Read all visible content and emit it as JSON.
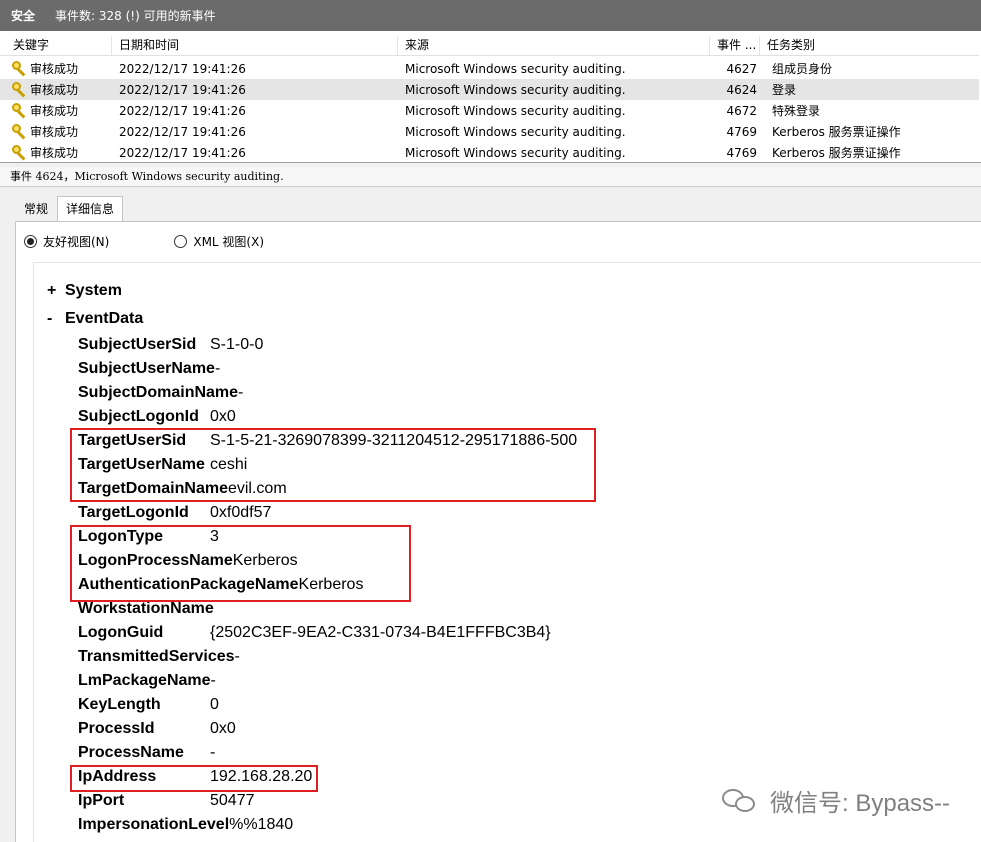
{
  "header": {
    "title": "安全",
    "event_count": "事件数: 328 (!) 可用的新事件"
  },
  "grid": {
    "columns": [
      "关键字",
      "日期和时间",
      "来源",
      "事件 ...",
      "任务类别"
    ],
    "rows": [
      {
        "keyword": "审核成功",
        "datetime": "2022/12/17 19:41:26",
        "source": "Microsoft Windows security auditing.",
        "event_id": "4627",
        "task": "组成员身份"
      },
      {
        "keyword": "审核成功",
        "datetime": "2022/12/17 19:41:26",
        "source": "Microsoft Windows security auditing.",
        "event_id": "4624",
        "task": "登录"
      },
      {
        "keyword": "审核成功",
        "datetime": "2022/12/17 19:41:26",
        "source": "Microsoft Windows security auditing.",
        "event_id": "4672",
        "task": "特殊登录"
      },
      {
        "keyword": "审核成功",
        "datetime": "2022/12/17 19:41:26",
        "source": "Microsoft Windows security auditing.",
        "event_id": "4769",
        "task": "Kerberos 服务票证操作"
      },
      {
        "keyword": "审核成功",
        "datetime": "2022/12/17 19:41:26",
        "source": "Microsoft Windows security auditing.",
        "event_id": "4769",
        "task": "Kerberos 服务票证操作"
      }
    ],
    "selected_row": 1,
    "row_icon": "key-icon"
  },
  "detail": {
    "description": "事件 4624，Microsoft Windows security auditing.",
    "tabs": [
      "常规",
      "详细信息"
    ],
    "active_tab": "详细信息",
    "view_options": {
      "friendly": "友好视图(N)",
      "xml": "XML 视图(X)",
      "selected": "friendly"
    },
    "system_node": "System",
    "system_sign": "+",
    "eventdata_node": "EventData",
    "eventdata_sign": "-",
    "fields": [
      {
        "key": "SubjectUserSid",
        "value": "S-1-0-0"
      },
      {
        "key": "SubjectUserName",
        "value": "-"
      },
      {
        "key": "SubjectDomainName",
        "value": "-"
      },
      {
        "key": "SubjectLogonId",
        "value": "0x0"
      },
      {
        "key": "TargetUserSid",
        "value": "S-1-5-21-3269078399-3211204512-295171886-500"
      },
      {
        "key": "TargetUserName",
        "value": "ceshi"
      },
      {
        "key": "TargetDomainName",
        "value": "evil.com"
      },
      {
        "key": "TargetLogonId",
        "value": "0xf0df57"
      },
      {
        "key": "LogonType",
        "value": "3"
      },
      {
        "key": "LogonProcessName",
        "value": "Kerberos"
      },
      {
        "key": "AuthenticationPackageName",
        "value": "Kerberos"
      },
      {
        "key": "WorkstationName",
        "value": ""
      },
      {
        "key": "LogonGuid",
        "value": "{2502C3EF-9EA2-C331-0734-B4E1FFFBC3B4}"
      },
      {
        "key": "TransmittedServices",
        "value": "-"
      },
      {
        "key": "LmPackageName",
        "value": "-"
      },
      {
        "key": "KeyLength",
        "value": "0"
      },
      {
        "key": "ProcessId",
        "value": "0x0"
      },
      {
        "key": "ProcessName",
        "value": "-"
      },
      {
        "key": "IpAddress",
        "value": "192.168.28.20"
      },
      {
        "key": "IpPort",
        "value": "50477"
      },
      {
        "key": "ImpersonationLevel",
        "value": "%%1840"
      }
    ],
    "highlight_color": "#e02020"
  },
  "watermark": {
    "text": "微信号: Bypass--",
    "icon": "wechat-icon"
  }
}
